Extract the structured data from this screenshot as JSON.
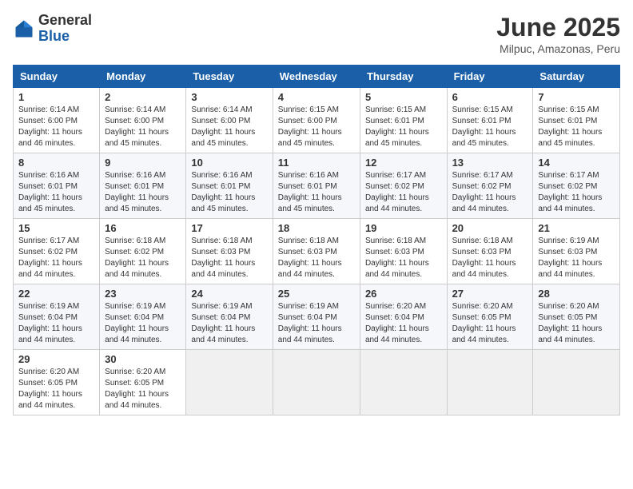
{
  "header": {
    "logo_general": "General",
    "logo_blue": "Blue",
    "month_title": "June 2025",
    "location": "Milpuc, Amazonas, Peru"
  },
  "weekdays": [
    "Sunday",
    "Monday",
    "Tuesday",
    "Wednesday",
    "Thursday",
    "Friday",
    "Saturday"
  ],
  "weeks": [
    [
      {
        "day": "1",
        "sunrise": "6:14 AM",
        "sunset": "6:00 PM",
        "daylight": "11 hours and 46 minutes."
      },
      {
        "day": "2",
        "sunrise": "6:14 AM",
        "sunset": "6:00 PM",
        "daylight": "11 hours and 45 minutes."
      },
      {
        "day": "3",
        "sunrise": "6:14 AM",
        "sunset": "6:00 PM",
        "daylight": "11 hours and 45 minutes."
      },
      {
        "day": "4",
        "sunrise": "6:15 AM",
        "sunset": "6:00 PM",
        "daylight": "11 hours and 45 minutes."
      },
      {
        "day": "5",
        "sunrise": "6:15 AM",
        "sunset": "6:01 PM",
        "daylight": "11 hours and 45 minutes."
      },
      {
        "day": "6",
        "sunrise": "6:15 AM",
        "sunset": "6:01 PM",
        "daylight": "11 hours and 45 minutes."
      },
      {
        "day": "7",
        "sunrise": "6:15 AM",
        "sunset": "6:01 PM",
        "daylight": "11 hours and 45 minutes."
      }
    ],
    [
      {
        "day": "8",
        "sunrise": "6:16 AM",
        "sunset": "6:01 PM",
        "daylight": "11 hours and 45 minutes."
      },
      {
        "day": "9",
        "sunrise": "6:16 AM",
        "sunset": "6:01 PM",
        "daylight": "11 hours and 45 minutes."
      },
      {
        "day": "10",
        "sunrise": "6:16 AM",
        "sunset": "6:01 PM",
        "daylight": "11 hours and 45 minutes."
      },
      {
        "day": "11",
        "sunrise": "6:16 AM",
        "sunset": "6:01 PM",
        "daylight": "11 hours and 45 minutes."
      },
      {
        "day": "12",
        "sunrise": "6:17 AM",
        "sunset": "6:02 PM",
        "daylight": "11 hours and 44 minutes."
      },
      {
        "day": "13",
        "sunrise": "6:17 AM",
        "sunset": "6:02 PM",
        "daylight": "11 hours and 44 minutes."
      },
      {
        "day": "14",
        "sunrise": "6:17 AM",
        "sunset": "6:02 PM",
        "daylight": "11 hours and 44 minutes."
      }
    ],
    [
      {
        "day": "15",
        "sunrise": "6:17 AM",
        "sunset": "6:02 PM",
        "daylight": "11 hours and 44 minutes."
      },
      {
        "day": "16",
        "sunrise": "6:18 AM",
        "sunset": "6:02 PM",
        "daylight": "11 hours and 44 minutes."
      },
      {
        "day": "17",
        "sunrise": "6:18 AM",
        "sunset": "6:03 PM",
        "daylight": "11 hours and 44 minutes."
      },
      {
        "day": "18",
        "sunrise": "6:18 AM",
        "sunset": "6:03 PM",
        "daylight": "11 hours and 44 minutes."
      },
      {
        "day": "19",
        "sunrise": "6:18 AM",
        "sunset": "6:03 PM",
        "daylight": "11 hours and 44 minutes."
      },
      {
        "day": "20",
        "sunrise": "6:18 AM",
        "sunset": "6:03 PM",
        "daylight": "11 hours and 44 minutes."
      },
      {
        "day": "21",
        "sunrise": "6:19 AM",
        "sunset": "6:03 PM",
        "daylight": "11 hours and 44 minutes."
      }
    ],
    [
      {
        "day": "22",
        "sunrise": "6:19 AM",
        "sunset": "6:04 PM",
        "daylight": "11 hours and 44 minutes."
      },
      {
        "day": "23",
        "sunrise": "6:19 AM",
        "sunset": "6:04 PM",
        "daylight": "11 hours and 44 minutes."
      },
      {
        "day": "24",
        "sunrise": "6:19 AM",
        "sunset": "6:04 PM",
        "daylight": "11 hours and 44 minutes."
      },
      {
        "day": "25",
        "sunrise": "6:19 AM",
        "sunset": "6:04 PM",
        "daylight": "11 hours and 44 minutes."
      },
      {
        "day": "26",
        "sunrise": "6:20 AM",
        "sunset": "6:04 PM",
        "daylight": "11 hours and 44 minutes."
      },
      {
        "day": "27",
        "sunrise": "6:20 AM",
        "sunset": "6:05 PM",
        "daylight": "11 hours and 44 minutes."
      },
      {
        "day": "28",
        "sunrise": "6:20 AM",
        "sunset": "6:05 PM",
        "daylight": "11 hours and 44 minutes."
      }
    ],
    [
      {
        "day": "29",
        "sunrise": "6:20 AM",
        "sunset": "6:05 PM",
        "daylight": "11 hours and 44 minutes."
      },
      {
        "day": "30",
        "sunrise": "6:20 AM",
        "sunset": "6:05 PM",
        "daylight": "11 hours and 44 minutes."
      },
      null,
      null,
      null,
      null,
      null
    ]
  ]
}
